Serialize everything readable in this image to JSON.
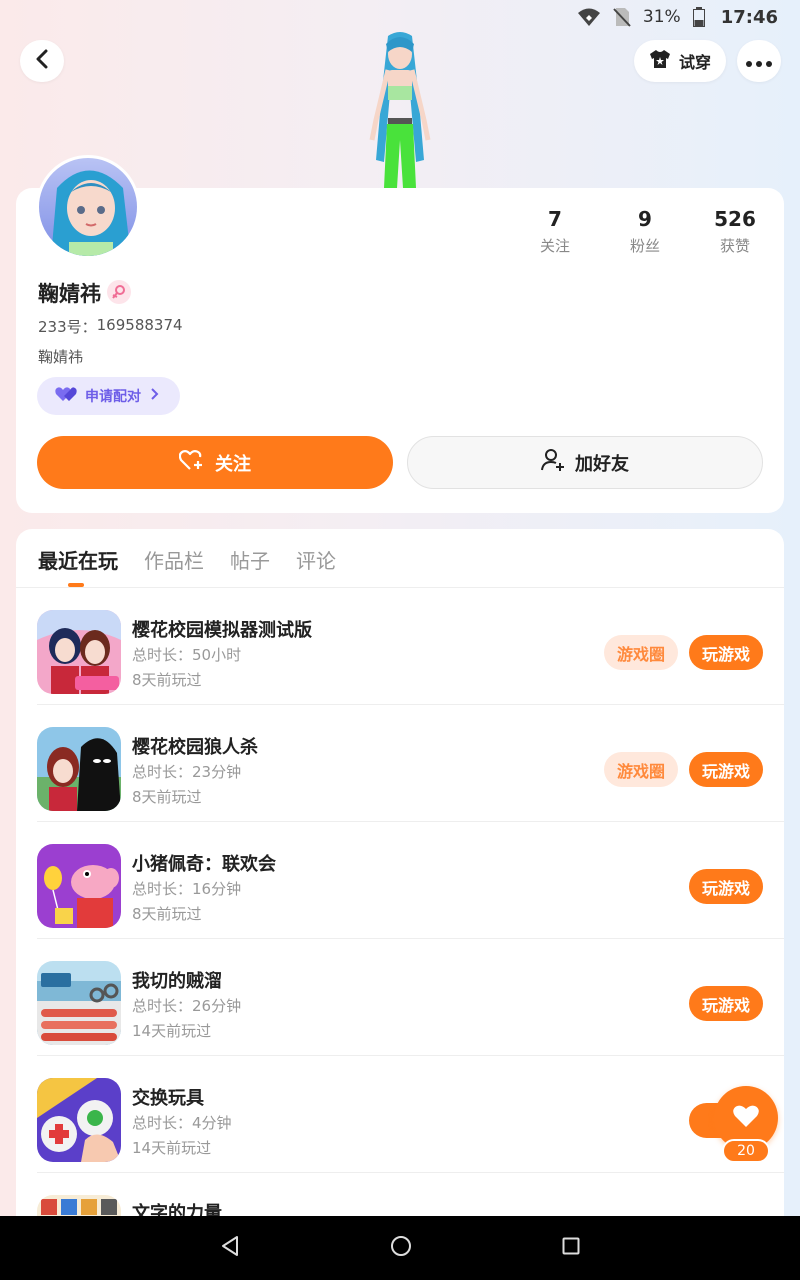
{
  "status_bar": {
    "battery": "31%",
    "time": "17:46"
  },
  "header": {
    "tryon_label": "试穿"
  },
  "profile": {
    "name": "鞠婧祎",
    "id_label": "233号：",
    "id_value": "169588374",
    "bio": "鞠婧祎",
    "pair_label": "申请配对",
    "stats": [
      {
        "value": "7",
        "label": "关注"
      },
      {
        "value": "9",
        "label": "粉丝"
      },
      {
        "value": "526",
        "label": "获赞"
      }
    ],
    "follow_label": "关注",
    "add_friend_label": "加好友"
  },
  "tabs": [
    "最近在玩",
    "作品栏",
    "帖子",
    "评论"
  ],
  "games": [
    {
      "title": "樱花校园模拟器测试版",
      "time": "总时长：50小时",
      "last": "8天前玩过",
      "circle": "游戏圈",
      "play": "玩游戏",
      "icon": "sakura-test-icon"
    },
    {
      "title": "樱花校园狼人杀",
      "time": "总时长：23分钟",
      "last": "8天前玩过",
      "circle": "游戏圈",
      "play": "玩游戏",
      "icon": "sakura-werewolf-icon"
    },
    {
      "title": "小猪佩奇：联欢会",
      "time": "总时长：16分钟",
      "last": "8天前玩过",
      "play": "玩游戏",
      "icon": "peppa-pig-icon"
    },
    {
      "title": "我切的贼溜",
      "time": "总时长：26分钟",
      "last": "14天前玩过",
      "play": "玩游戏",
      "icon": "cutting-game-icon"
    },
    {
      "title": "交换玩具",
      "time": "总时长：4分钟",
      "last": "14天前玩过",
      "play": "玩",
      "icon": "swap-toys-icon"
    },
    {
      "title": "文字的力量",
      "icon": "word-power-icon"
    }
  ],
  "like": {
    "count": "20"
  },
  "colors": {
    "accent": "#ff7a1a",
    "pair": "#6e5ee8"
  }
}
